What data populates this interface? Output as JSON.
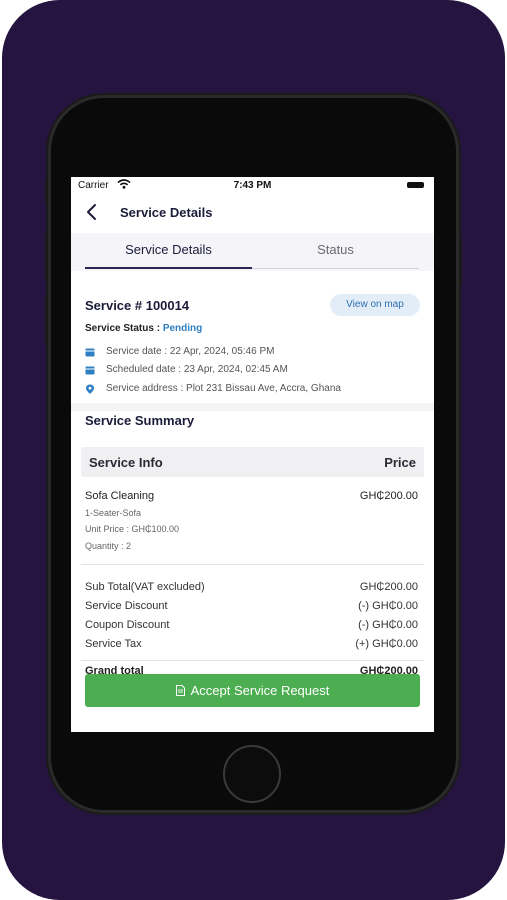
{
  "colors": {
    "background": "#261440",
    "accent_green": "#4cae51",
    "pending_blue": "#2f7fc4",
    "map_button_bg": "#e3edf7"
  },
  "status_bar": {
    "carrier": "Carrier",
    "time": "7:43 PM",
    "wifi_icon": "wifi-icon",
    "battery_icon": "battery-icon"
  },
  "header": {
    "title": "Service Details",
    "back_icon": "chevron-left-icon"
  },
  "tabs": [
    {
      "label": "Service Details",
      "active": true
    },
    {
      "label": "Status",
      "active": false
    }
  ],
  "service": {
    "number_label": "Service # 100014",
    "map_button": "View on map",
    "status_label": "Service Status : ",
    "status_value": "Pending",
    "date_text": "Service date : 22 Apr, 2024, 05:46 PM",
    "scheduled_text": "Scheduled date :  23 Apr, 2024, 02:45 AM",
    "address_text": "Service address  : Plot 231 Bissau Ave, Accra, Ghana"
  },
  "summary": {
    "title": "Service Summary",
    "col_left": "Service Info",
    "col_right": "Price",
    "item": {
      "name": "Sofa Cleaning",
      "price": "GH₵200.00",
      "variant": "1-Seater-Sofa",
      "unit_price": "Unit Price : GH₵100.00",
      "quantity": "Quantity : 2"
    },
    "rows": [
      {
        "label": "Sub Total(VAT excluded)",
        "value": "GH₵200.00"
      },
      {
        "label": "Service Discount",
        "value": "(-) GH₵0.00"
      },
      {
        "label": "Coupon Discount",
        "value": "(-) GH₵0.00"
      },
      {
        "label": "Service Tax",
        "value": "(+) GH₵0.00"
      }
    ],
    "grand_label": "Grand total",
    "grand_value": "GH₵200.00"
  },
  "actions": {
    "accept_label": "Accept Service Request",
    "accept_icon": "document-icon"
  }
}
